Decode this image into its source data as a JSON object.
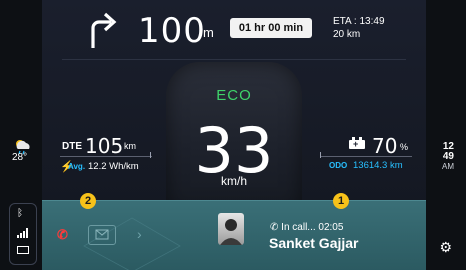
{
  "navigation": {
    "turn_icon": "turn-right-arrow",
    "distance": "100",
    "distance_unit": "m",
    "duration": "01 hr 00 min",
    "eta_line": "ETA : 13:49",
    "eta_distance": "20 km"
  },
  "drive": {
    "mode": "ECO",
    "speed": "33",
    "speed_unit": "km/h",
    "dte_label": "DTE",
    "dte_value": "105",
    "dte_unit": "km",
    "avg_label": "Avg.",
    "avg_value": "12.2 Wh/km",
    "battery_value": "70",
    "battery_unit": "%",
    "odo_label": "ODO",
    "odo_value": "13614.3 km"
  },
  "call": {
    "status": "In call... 02:05",
    "name": "Sanket Gajjar",
    "avatar": "contact-avatar"
  },
  "badges": {
    "left": "2",
    "right": "1"
  },
  "left_rail": {
    "weather_icon": "partly-cloudy-rain",
    "temperature": "28°",
    "bluetooth_icon": "bluetooth",
    "signal_icon": "signal-bars",
    "battery_icon": "phone-battery"
  },
  "right_rail": {
    "hour": "12",
    "minute": "49",
    "ampm": "AM",
    "settings_icon": "gear"
  },
  "colors": {
    "accent_green": "#3fd46a",
    "accent_cyan": "#28c0ff",
    "panel_teal": "#2b5a61",
    "badge_yellow": "#f7c21a",
    "alert_red": "#ff3a3a"
  }
}
